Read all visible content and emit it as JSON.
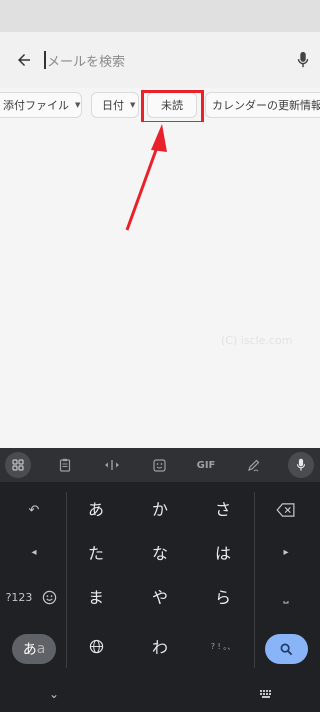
{
  "search": {
    "placeholder": "メールを検索"
  },
  "filters": {
    "chips": [
      {
        "label": "添付ファイル",
        "has_dropdown": true
      },
      {
        "label": "日付",
        "has_dropdown": true
      },
      {
        "label": "未読",
        "has_dropdown": false,
        "highlighted": true
      },
      {
        "label": "カレンダーの更新情報を除",
        "has_dropdown": false
      }
    ]
  },
  "watermark": "(C) iscle.com",
  "annotation": {
    "color": "#e8212a"
  },
  "keyboard": {
    "toolbar": {
      "gif_label": "GIF"
    },
    "rows": [
      [
        "あ",
        "か",
        "さ"
      ],
      [
        "た",
        "な",
        "は"
      ],
      [
        "ま",
        "や",
        "ら"
      ],
      [
        "",
        "わ",
        ""
      ]
    ],
    "left_keys": {
      "undo": "↶",
      "left": "◂",
      "num": "?123"
    },
    "right_keys": {
      "right": "▸",
      "space": "⎵"
    },
    "punct_key": "? ! 。、",
    "mode_key": {
      "main": "あ",
      "dim": "a"
    },
    "nav": {
      "down": "⌄",
      "keyboard_icon": "keyboard-icon"
    }
  },
  "colors": {
    "accent": "#8ab4f8",
    "highlight": "#e8212a",
    "keyboard_bg": "#202124"
  }
}
